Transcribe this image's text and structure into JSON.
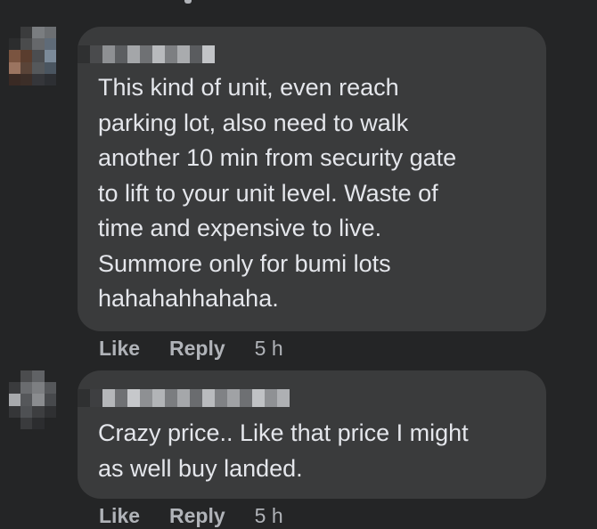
{
  "comments": [
    {
      "text": "This kind of unit, even reach\nparking lot, also need to walk\nanother 10 min from security gate\nto lift to your unit level. Waste of\ntime and expensive to live.\nSummore only for bumi lots\nhahahahhahaha.",
      "like_label": "Like",
      "reply_label": "Reply",
      "timestamp": "5 h"
    },
    {
      "text": "Crazy price.. Like that price I might\nas well buy landed.",
      "like_label": "Like",
      "reply_label": "Reply",
      "timestamp": "5 h"
    }
  ],
  "colors": {
    "background": "#242526",
    "bubble": "#3a3b3c",
    "text": "#e4e6eb",
    "secondary_text": "#b0b3b8"
  }
}
